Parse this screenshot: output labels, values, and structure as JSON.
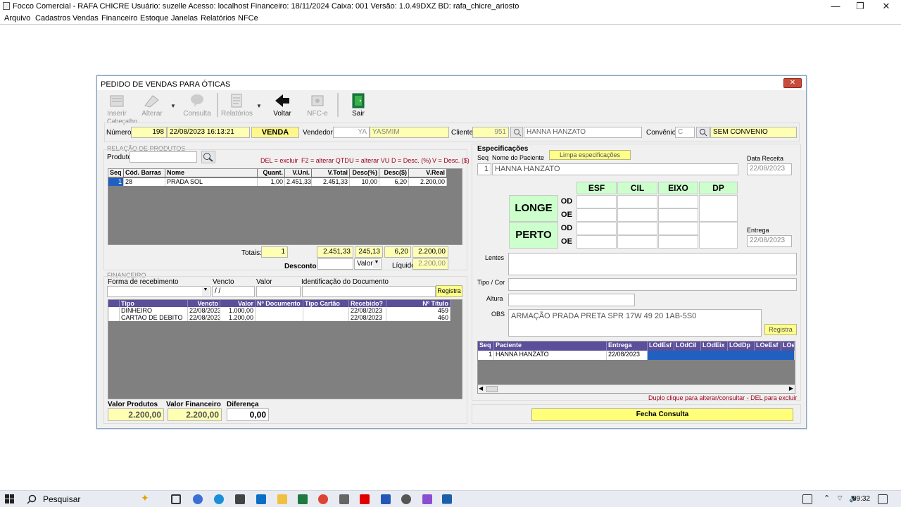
{
  "window": {
    "title": "Focco Comercial - RAFA CHICRE   Usuário: suzelle   Acesso: localhost   Financeiro: 18/11/2024   Caixa: 001   Versão: 1.0.49DXZ   BD: rafa_chicre_ariosto",
    "minimize": "—",
    "restore": "❐",
    "close": "✕"
  },
  "menu": [
    "Arquivo",
    "Cadastros",
    "Vendas",
    "Financeiro",
    "Estoque",
    "Janelas",
    "Relatórios",
    "NFCe"
  ],
  "dialog": {
    "title": "PEDIDO DE VENDAS PARA ÓTICAS",
    "close": "✕"
  },
  "toolbar": {
    "inserir": "Inserir",
    "alterar": "Alterar",
    "consulta": "Consulta",
    "relatorios": "Relatórios",
    "voltar": "Voltar",
    "nfce": "NFC-e",
    "sair": "Sair"
  },
  "header": {
    "group": "Cabeçalho",
    "numero_label": "Número",
    "numero": "198",
    "datetime": "22/08/2023 16:13:21",
    "tipo": "VENDA",
    "vendedor_label": "Vendedor",
    "vendedor_code": "YA",
    "vendedor_name": "YASMIM",
    "cliente_label": "Cliente",
    "cliente_code": "951",
    "cliente_name": "HANNA HANZATO",
    "convenio_label": "Convênio",
    "convenio_code": "C",
    "convenio_name": "SEM CONVENIO"
  },
  "produtos": {
    "group": "Relação de Produtos",
    "produto_label": "Produto",
    "hints": [
      "DEL = excluir",
      "F2 = alterar QTD",
      "U = alterar VU",
      "D = Desc. (%)",
      "V = Desc. ($)"
    ],
    "columns": [
      "Seq",
      "Cód. Barras",
      "Nome",
      "Quant.",
      "V.Uni.",
      "V.Total",
      "Desc(%)",
      "Desc($)",
      "V.Real"
    ],
    "rows": [
      [
        "1",
        "28",
        "PRADA SOL",
        "1,00",
        "2.451,33",
        "2.451,33",
        "10,00",
        "6,20",
        "2.200,00"
      ]
    ],
    "totais_label": "Totais:",
    "tot_qtd": "1",
    "tot_total": "2.451,33",
    "tot_desc_pct": "245,13",
    "tot_desc_val": "6,20",
    "tot_real": "2.200,00",
    "desconto_label": "Desconto",
    "desconto_tipo": "Valor",
    "liquido_label": "Líquido",
    "liquido": "2.200,00"
  },
  "financeiro": {
    "group": "Financeiro",
    "forma_label": "Forma de recebimento",
    "vencto_label": "Vencto",
    "vencto_value": " / /",
    "valor_label": "Valor",
    "ident_label": "Identificação do  Documento",
    "registra": "Registra",
    "columns": [
      "Tipo",
      "Vencto",
      "Valor",
      "Nº Documento",
      "Tipo Cartão",
      "Recebido?",
      "Nº Título"
    ],
    "rows": [
      [
        "DINHEIRO",
        "22/08/2023",
        "1.000,00",
        "",
        "",
        "22/08/2023",
        "459"
      ],
      [
        "CARTAO DE DEBITO",
        "22/08/2023",
        "1.200,00",
        "",
        "",
        "22/08/2023",
        "460"
      ]
    ]
  },
  "summary": {
    "vp_label": "Valor Produtos",
    "vp": "2.200,00",
    "vf_label": "Valor Financeiro",
    "vf": "2.200,00",
    "dif_label": "Diferença",
    "dif": "0,00"
  },
  "spec": {
    "group": "Especificações",
    "seq_label": "Seq",
    "nome_label": "Nome do Paciente",
    "limpa": "Limpa especificações",
    "seq": "1",
    "paciente": "HANNA HANZATO",
    "data_receita_label": "Data Receita",
    "data_receita": "22/08/2023",
    "entrega_label": "Entrega",
    "entrega": "22/08/2023",
    "cols": [
      "ESF",
      "CIL",
      "EIXO",
      "DP"
    ],
    "longe": "LONGE",
    "perto": "PERTO",
    "od": "OD",
    "oe": "OE",
    "lentes_label": "Lentes",
    "tipo_label": "Tipo / Cor",
    "altura_label": "Altura",
    "obs_label": "OBS",
    "obs": "ARMAÇÃO PRADA PRETA SPR 17W 49 20 1AB-5S0",
    "registra": "Registra",
    "grid_columns": [
      "Seq",
      "Paciente",
      "Entrega",
      "LOdEsf",
      "LOdCil",
      "LOdEix",
      "LOdDp",
      "LOeEsf",
      "LOe"
    ],
    "grid_rows": [
      [
        "1",
        "HANNA HANZATO",
        "22/08/2023"
      ]
    ],
    "hint": "Duplo clique para alterar/consultar  -  DEL para excluir",
    "fecha": "Fecha Consulta"
  },
  "taskbar": {
    "search": "Pesquisar",
    "time": "09:32"
  }
}
